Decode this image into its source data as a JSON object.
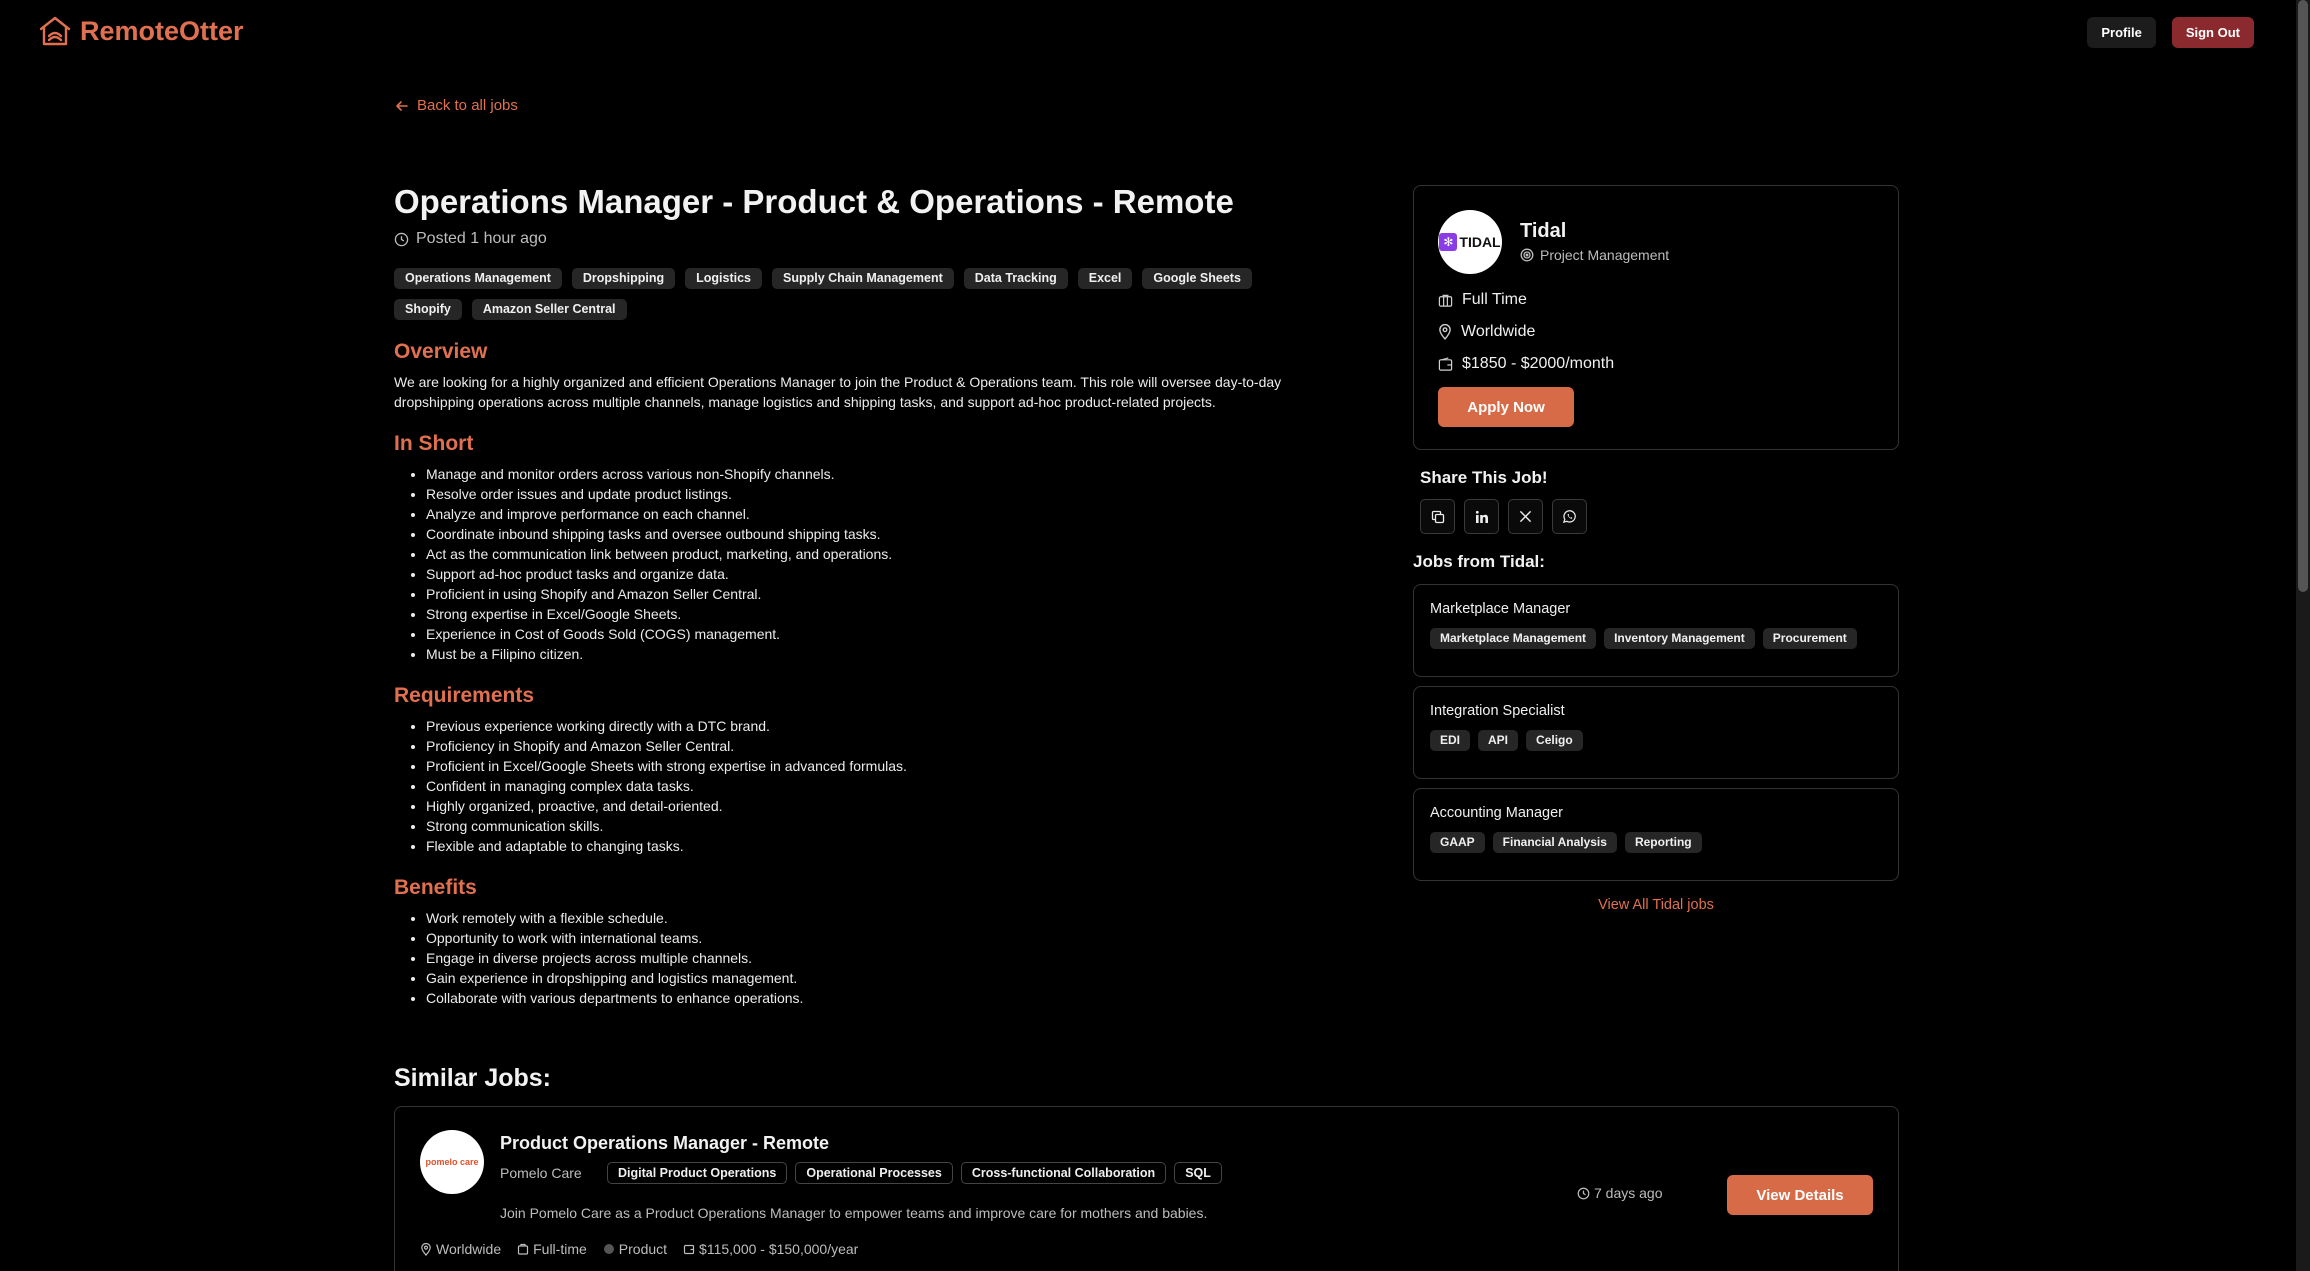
{
  "brand": {
    "name": "RemoteOtter",
    "accent": "#e07050"
  },
  "header": {
    "profile_label": "Profile",
    "signout_label": "Sign Out"
  },
  "back_label": "Back to all jobs",
  "job": {
    "title": "Operations Manager - Product & Operations - Remote",
    "posted": "Posted 1 hour ago",
    "tags": [
      "Operations Management",
      "Dropshipping",
      "Logistics",
      "Supply Chain Management",
      "Data Tracking",
      "Excel",
      "Google Sheets",
      "Shopify",
      "Amazon Seller Central"
    ],
    "overview_heading": "Overview",
    "overview": "We are looking for a highly organized and efficient Operations Manager to join the Product & Operations team. This role will oversee day-to-day dropshipping operations across multiple channels, manage logistics and shipping tasks, and support ad-hoc product-related projects.",
    "in_short_heading": "In Short",
    "in_short": [
      "Manage and monitor orders across various non-Shopify channels.",
      "Resolve order issues and update product listings.",
      "Analyze and improve performance on each channel.",
      "Coordinate inbound shipping tasks and oversee outbound shipping tasks.",
      "Act as the communication link between product, marketing, and operations.",
      "Support ad-hoc product tasks and organize data.",
      "Proficient in using Shopify and Amazon Seller Central.",
      "Strong expertise in Excel/Google Sheets.",
      "Experience in Cost of Goods Sold (COGS) management.",
      "Must be a Filipino citizen."
    ],
    "requirements_heading": "Requirements",
    "requirements": [
      "Previous experience working directly with a DTC brand.",
      "Proficiency in Shopify and Amazon Seller Central.",
      "Proficient in Excel/Google Sheets with strong expertise in advanced formulas.",
      "Confident in managing complex data tasks.",
      "Highly organized, proactive, and detail-oriented.",
      "Strong communication skills.",
      "Flexible and adaptable to changing tasks."
    ],
    "benefits_heading": "Benefits",
    "benefits": [
      "Work remotely with a flexible schedule.",
      "Opportunity to work with international teams.",
      "Engage in diverse projects across multiple channels.",
      "Gain experience in dropshipping and logistics management.",
      "Collaborate with various departments to enhance operations."
    ]
  },
  "company": {
    "logo_text": "TIDAL",
    "name": "Tidal",
    "category": "Project Management",
    "job_type": "Full Time",
    "location": "Worldwide",
    "salary": "$1850 - $2000/month",
    "apply_label": "Apply Now"
  },
  "share": {
    "heading": "Share This Job!",
    "icons": [
      "copy-icon",
      "linkedin-icon",
      "x-icon",
      "whatsapp-icon"
    ]
  },
  "jobs_from": {
    "heading": "Jobs from Tidal:",
    "items": [
      {
        "title": "Marketplace Manager",
        "tags": [
          "Marketplace Management",
          "Inventory Management",
          "Procurement"
        ]
      },
      {
        "title": "Integration Specialist",
        "tags": [
          "EDI",
          "API",
          "Celigo"
        ]
      },
      {
        "title": "Accounting Manager",
        "tags": [
          "GAAP",
          "Financial Analysis",
          "Reporting"
        ]
      }
    ],
    "view_all_label": "View All Tidal jobs"
  },
  "similar": {
    "heading": "Similar Jobs:",
    "items": [
      {
        "logo_text": "pomelo care",
        "title": "Product Operations Manager - Remote",
        "company": "Pomelo Care",
        "tags": [
          "Digital Product Operations",
          "Operational Processes",
          "Cross-functional Collaboration",
          "SQL"
        ],
        "description": "Join Pomelo Care as a Product Operations Manager to empower teams and improve care for mothers and babies.",
        "posted": "7 days ago",
        "view_label": "View Details",
        "location": "Worldwide",
        "job_type": "Full-time",
        "category": "Product",
        "salary": "$115,000 - $150,000/year"
      }
    ]
  }
}
